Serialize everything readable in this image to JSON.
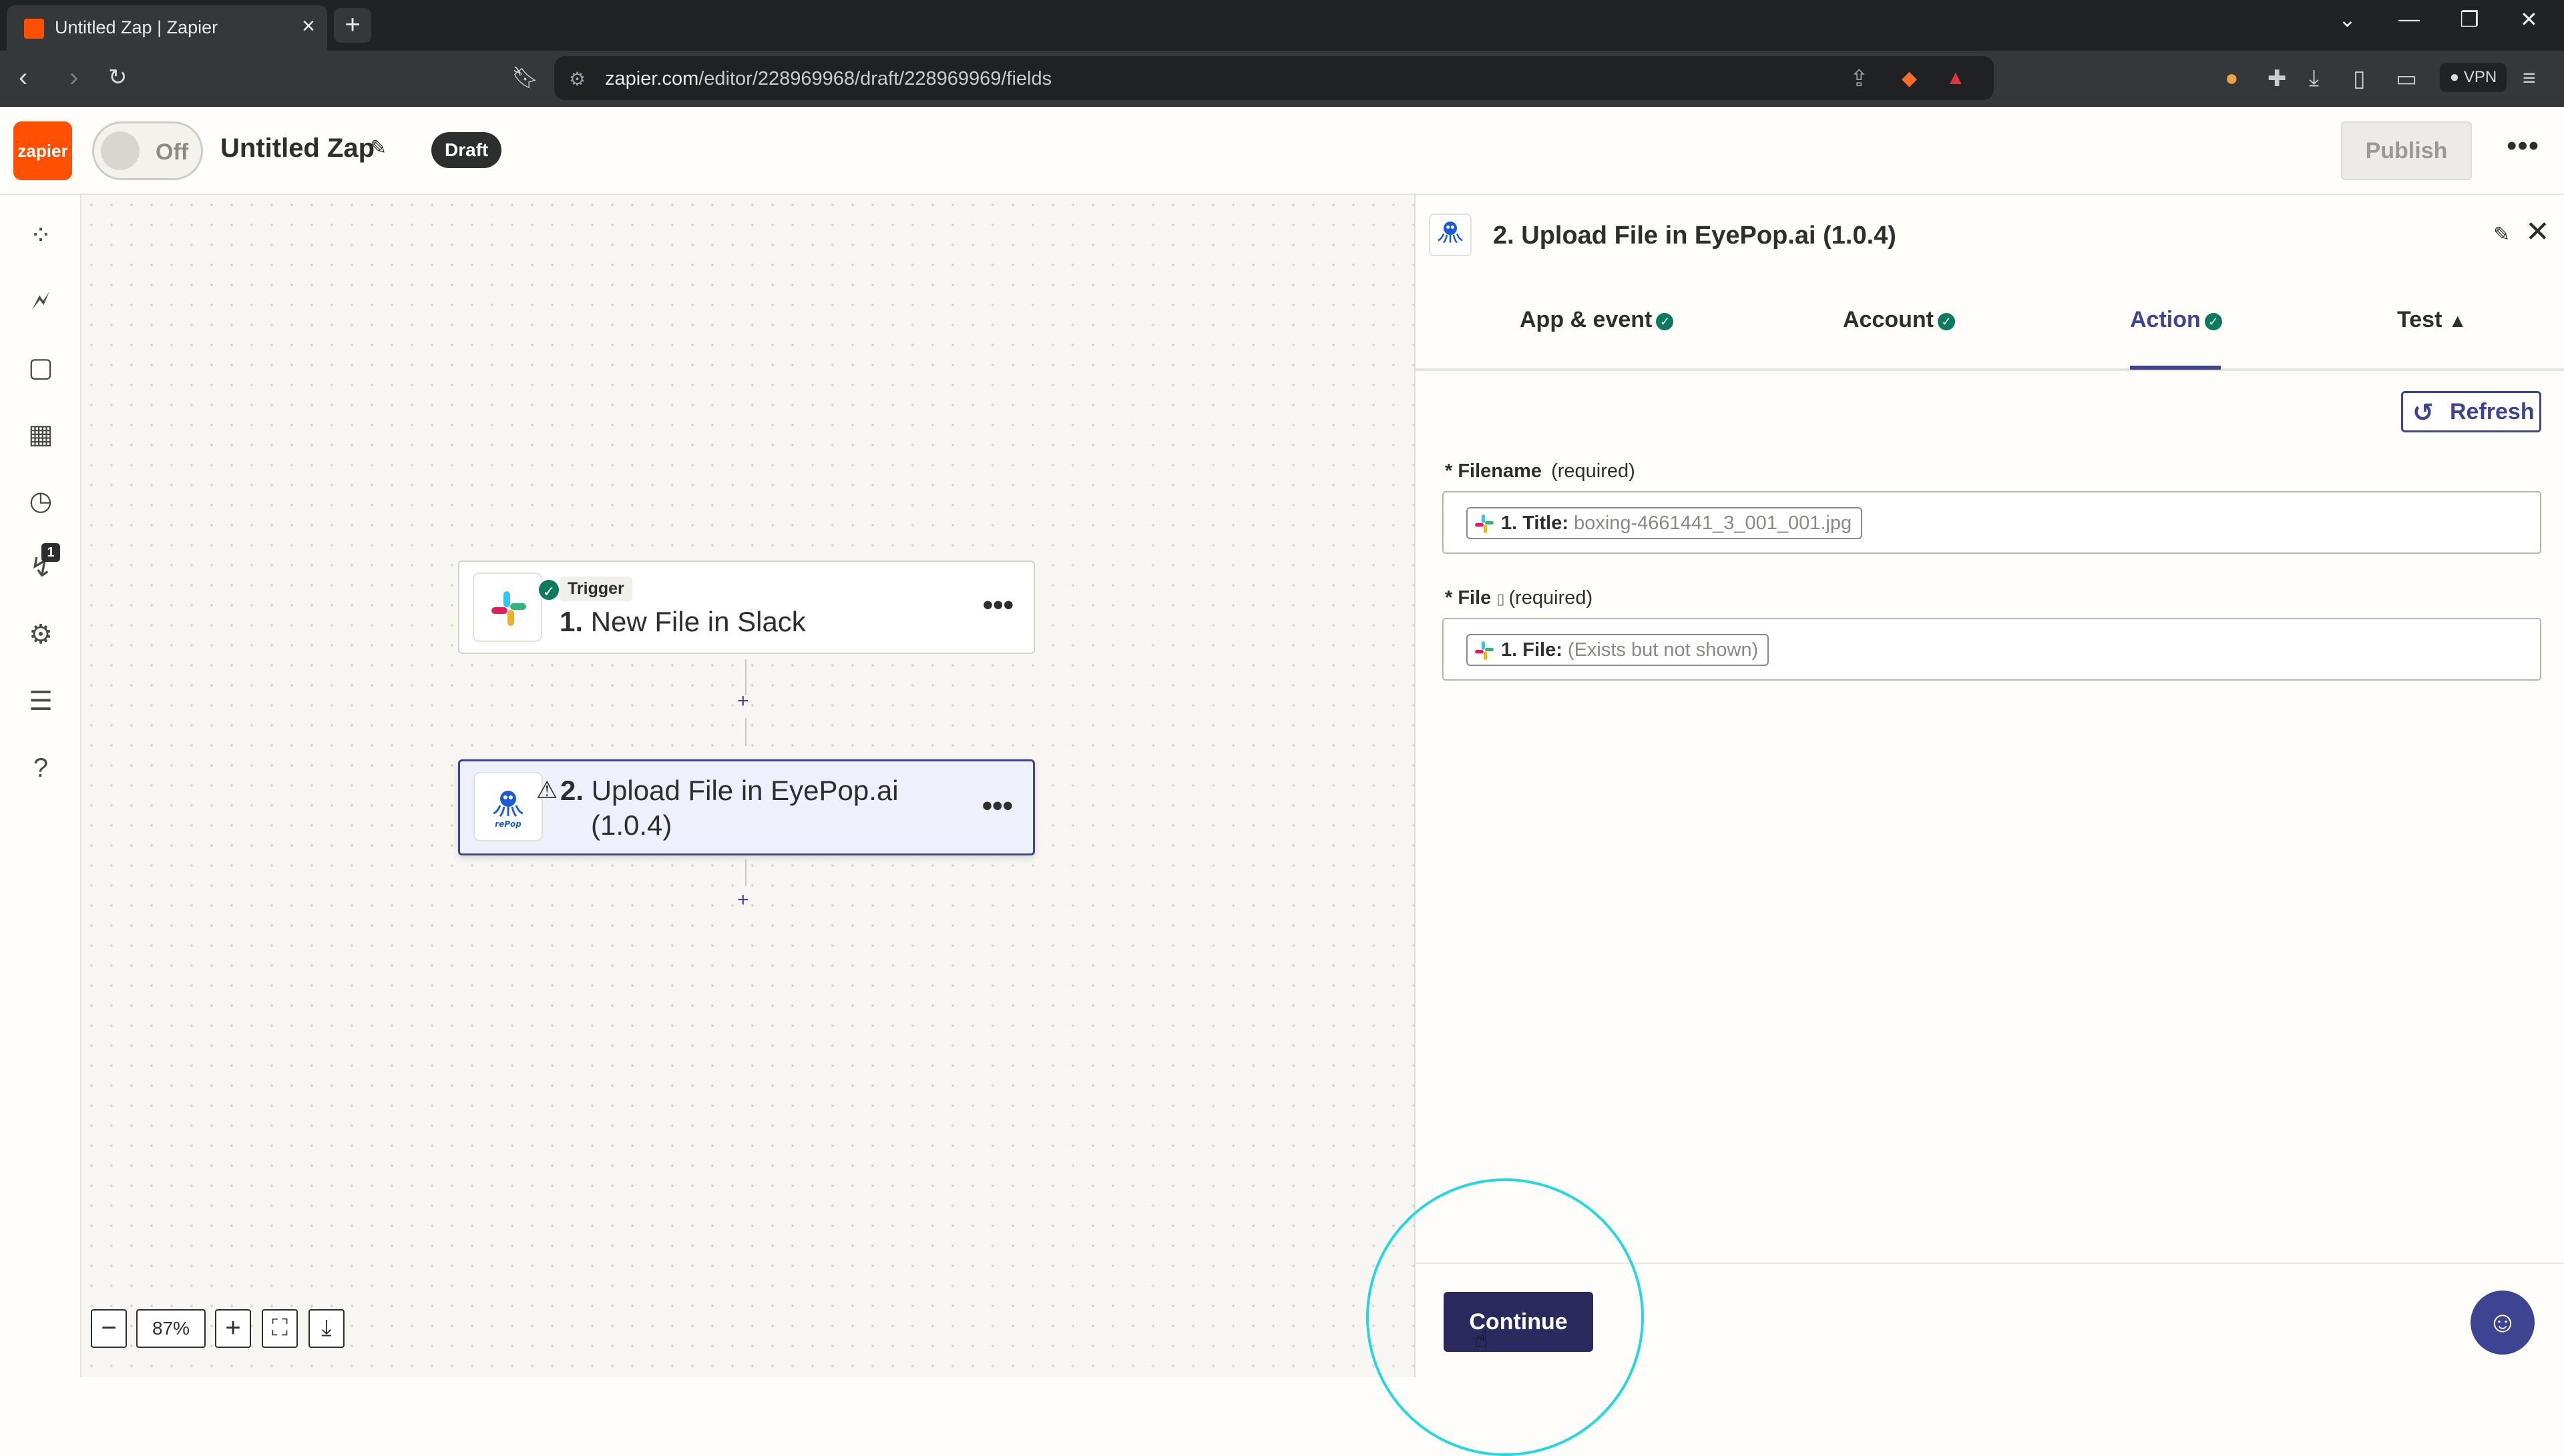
{
  "browser": {
    "tab_title": "Untitled Zap | Zapier",
    "url_host": "zapier.com",
    "url_path": "/editor/228969968/draft/228969969/fields",
    "vpn_label": "VPN"
  },
  "header": {
    "logo_text": "zapier",
    "toggle_label": "Off",
    "zap_title": "Untitled Zap",
    "status_badge": "Draft",
    "publish_label": "Publish"
  },
  "sidebar": {
    "notification_count": "1"
  },
  "canvas": {
    "steps": [
      {
        "pill": "Trigger",
        "number": "1.",
        "title": "New File in Slack",
        "status": "complete"
      },
      {
        "number": "2.",
        "title": "Upload File in EyePop.ai",
        "subtitle": "(1.0.4)",
        "status": "warning"
      }
    ],
    "zoom": "87%"
  },
  "panel": {
    "title": "2. Upload File in EyePop.ai (1.0.4)",
    "tabs": [
      {
        "label": "App & event",
        "status": "complete"
      },
      {
        "label": "Account",
        "status": "complete"
      },
      {
        "label": "Action",
        "status": "complete",
        "active": true
      },
      {
        "label": "Test",
        "status": "warning"
      }
    ],
    "refresh_label": "Refresh",
    "fields": [
      {
        "label": "Filename",
        "required": "(required)",
        "chip_key": "1. Title:",
        "chip_value": "boxing-4661441_3_001_001.jpg"
      },
      {
        "label": "File",
        "required": "(required)",
        "chip_key": "1. File:",
        "chip_value": "(Exists but not shown)"
      }
    ],
    "continue_label": "Continue"
  },
  "colors": {
    "zapier_orange": "#ff4f00",
    "accent": "#3d4592",
    "success": "#0d7a5f",
    "primary_button": "#2b2a5e"
  }
}
